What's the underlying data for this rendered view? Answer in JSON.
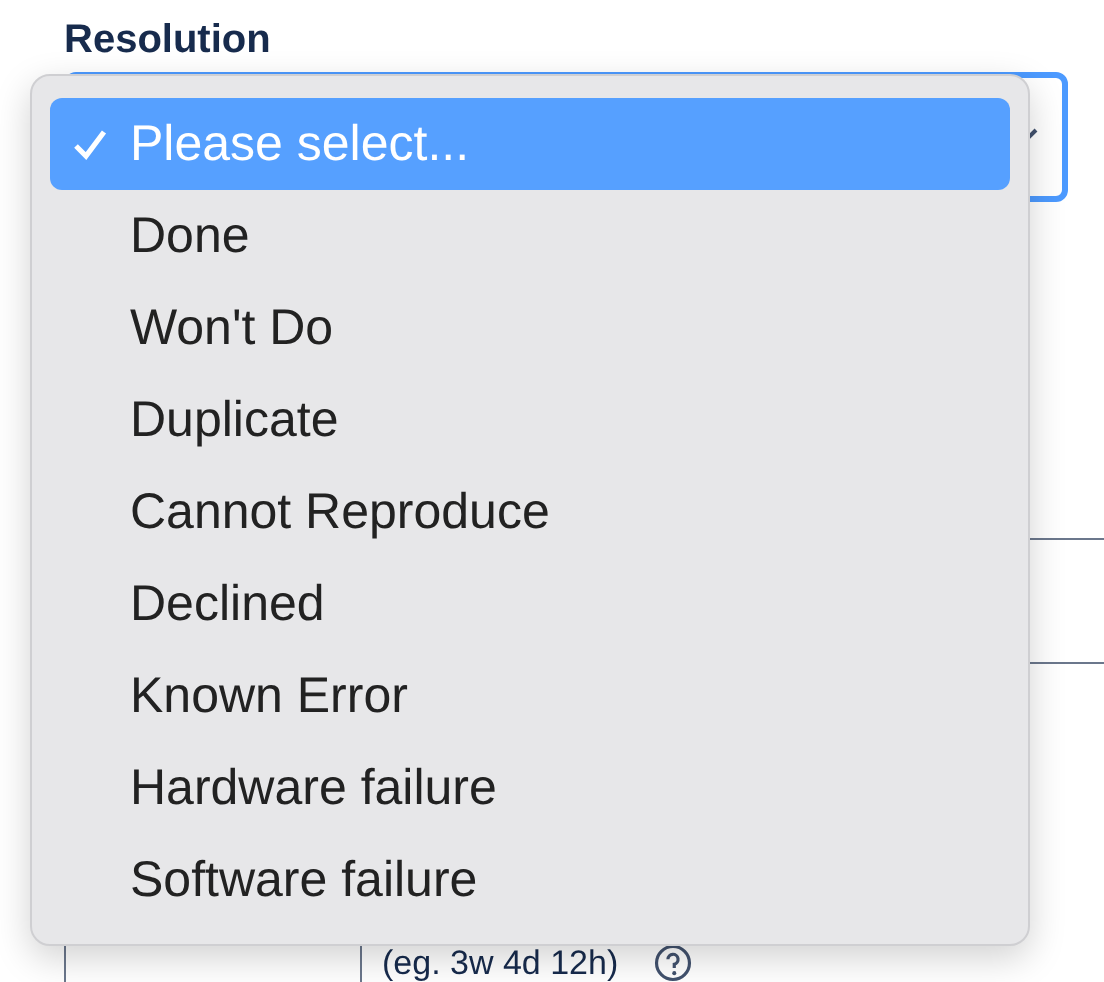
{
  "field": {
    "label": "Resolution"
  },
  "menu": {
    "options": [
      {
        "label": "Please select...",
        "selected": true
      },
      {
        "label": "Done",
        "selected": false
      },
      {
        "label": "Won't Do",
        "selected": false
      },
      {
        "label": "Duplicate",
        "selected": false
      },
      {
        "label": "Cannot Reproduce",
        "selected": false
      },
      {
        "label": "Declined",
        "selected": false
      },
      {
        "label": "Known Error",
        "selected": false
      },
      {
        "label": "Hardware failure",
        "selected": false
      },
      {
        "label": "Software failure",
        "selected": false
      }
    ]
  },
  "time_field": {
    "hint": "(eg. 3w 4d 12h)"
  }
}
